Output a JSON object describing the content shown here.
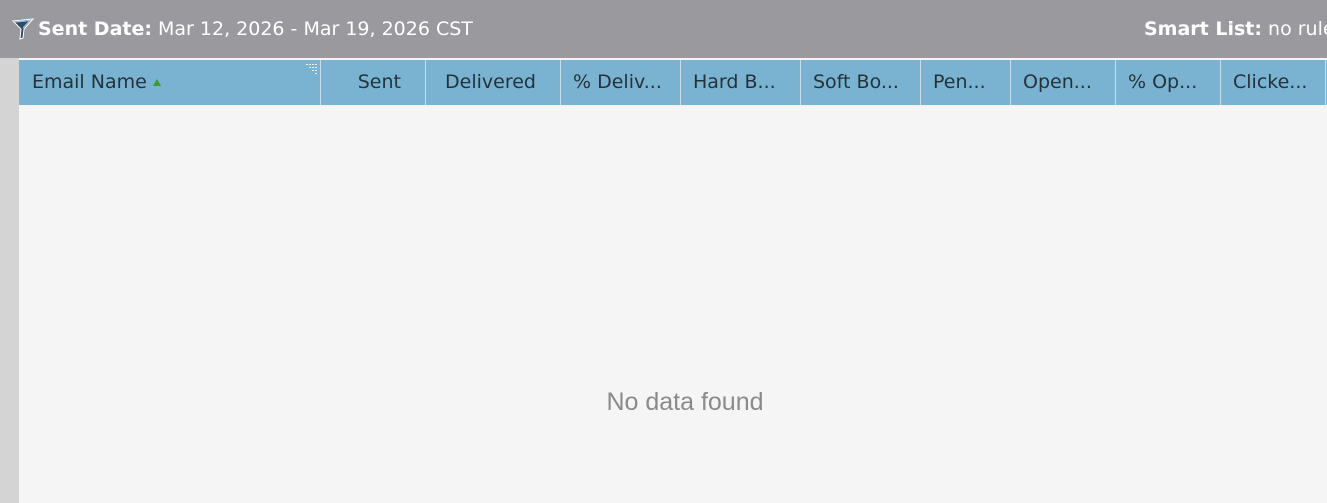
{
  "filters": {
    "sent_date_label": "Sent Date:",
    "sent_date_value": "Mar 12, 2026 - Mar 19, 2026 CST",
    "smart_list_label": "Smart List:",
    "smart_list_value": "no rules",
    "icon": "filter-funnel-icon"
  },
  "table": {
    "columns": [
      {
        "label": "Email Name",
        "sorted": "ascending"
      },
      {
        "label": "Sent"
      },
      {
        "label": "Delivered"
      },
      {
        "label": "% Deliv..."
      },
      {
        "label": "Hard B..."
      },
      {
        "label": "Soft Bo..."
      },
      {
        "label": "Pen..."
      },
      {
        "label": "Open..."
      },
      {
        "label": "% Op..."
      },
      {
        "label": "Clicke..."
      }
    ],
    "empty_message": "No data found"
  },
  "colors": {
    "topbar": "#9a999e",
    "header": "#7ab3d1",
    "sort_indicator": "#3a9b2e",
    "background": "#f5f5f5"
  }
}
